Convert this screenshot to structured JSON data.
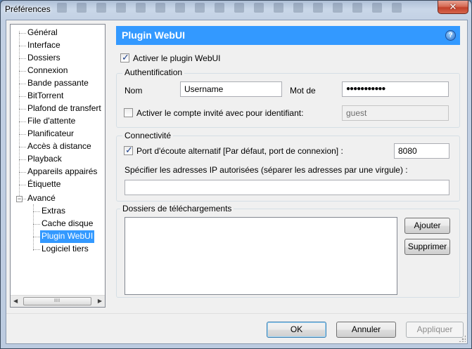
{
  "window": {
    "title": "Préférences",
    "close_glyph": "✕"
  },
  "tree": {
    "items": [
      {
        "label": "Général",
        "level": 0
      },
      {
        "label": "Interface",
        "level": 0
      },
      {
        "label": "Dossiers",
        "level": 0
      },
      {
        "label": "Connexion",
        "level": 0
      },
      {
        "label": "Bande passante",
        "level": 0
      },
      {
        "label": "BitTorrent",
        "level": 0
      },
      {
        "label": "Plafond de transfert",
        "level": 0
      },
      {
        "label": "File d'attente",
        "level": 0
      },
      {
        "label": "Planificateur",
        "level": 0
      },
      {
        "label": "Accès à distance",
        "level": 0
      },
      {
        "label": "Playback",
        "level": 0
      },
      {
        "label": "Appareils appairés",
        "level": 0
      },
      {
        "label": "Étiquette",
        "level": 0
      },
      {
        "label": "Avancé",
        "level": 0,
        "expanded": true
      },
      {
        "label": "Extras",
        "level": 1
      },
      {
        "label": "Cache disque",
        "level": 1
      },
      {
        "label": "Plugin WebUI",
        "level": 1,
        "selected": true
      },
      {
        "label": "Logiciel tiers",
        "level": 1
      }
    ],
    "expander_glyph": "−",
    "scroll_left": "◀",
    "scroll_right": "▶",
    "thumb_grip": "III"
  },
  "panel": {
    "title": "Plugin WebUI",
    "help_glyph": "?",
    "enable_label": "Activer le plugin WebUI",
    "enable_checked": true,
    "auth": {
      "title": "Authentification",
      "name_label": "Nom",
      "name_value": "Username",
      "password_label": "Mot de",
      "password_value": "●●●●●●●●●●●",
      "guest_label": "Activer le compte invité avec pour identifiant:",
      "guest_checked": false,
      "guest_value": "guest"
    },
    "connectivity": {
      "title": "Connectivité",
      "alt_port_label": "Port d'écoute alternatif [Par défaut, port de connexion] :",
      "alt_port_checked": true,
      "alt_port_value": "8080",
      "ip_label": "Spécifier les adresses IP autorisées (séparer les adresses par une virgule) :",
      "ip_value": ""
    },
    "downloads": {
      "title": "Dossiers de téléchargements",
      "add_label": "Ajouter",
      "remove_label": "Supprimer"
    }
  },
  "footer": {
    "ok_label": "OK",
    "cancel_label": "Annuler",
    "apply_label": "Appliquer"
  }
}
